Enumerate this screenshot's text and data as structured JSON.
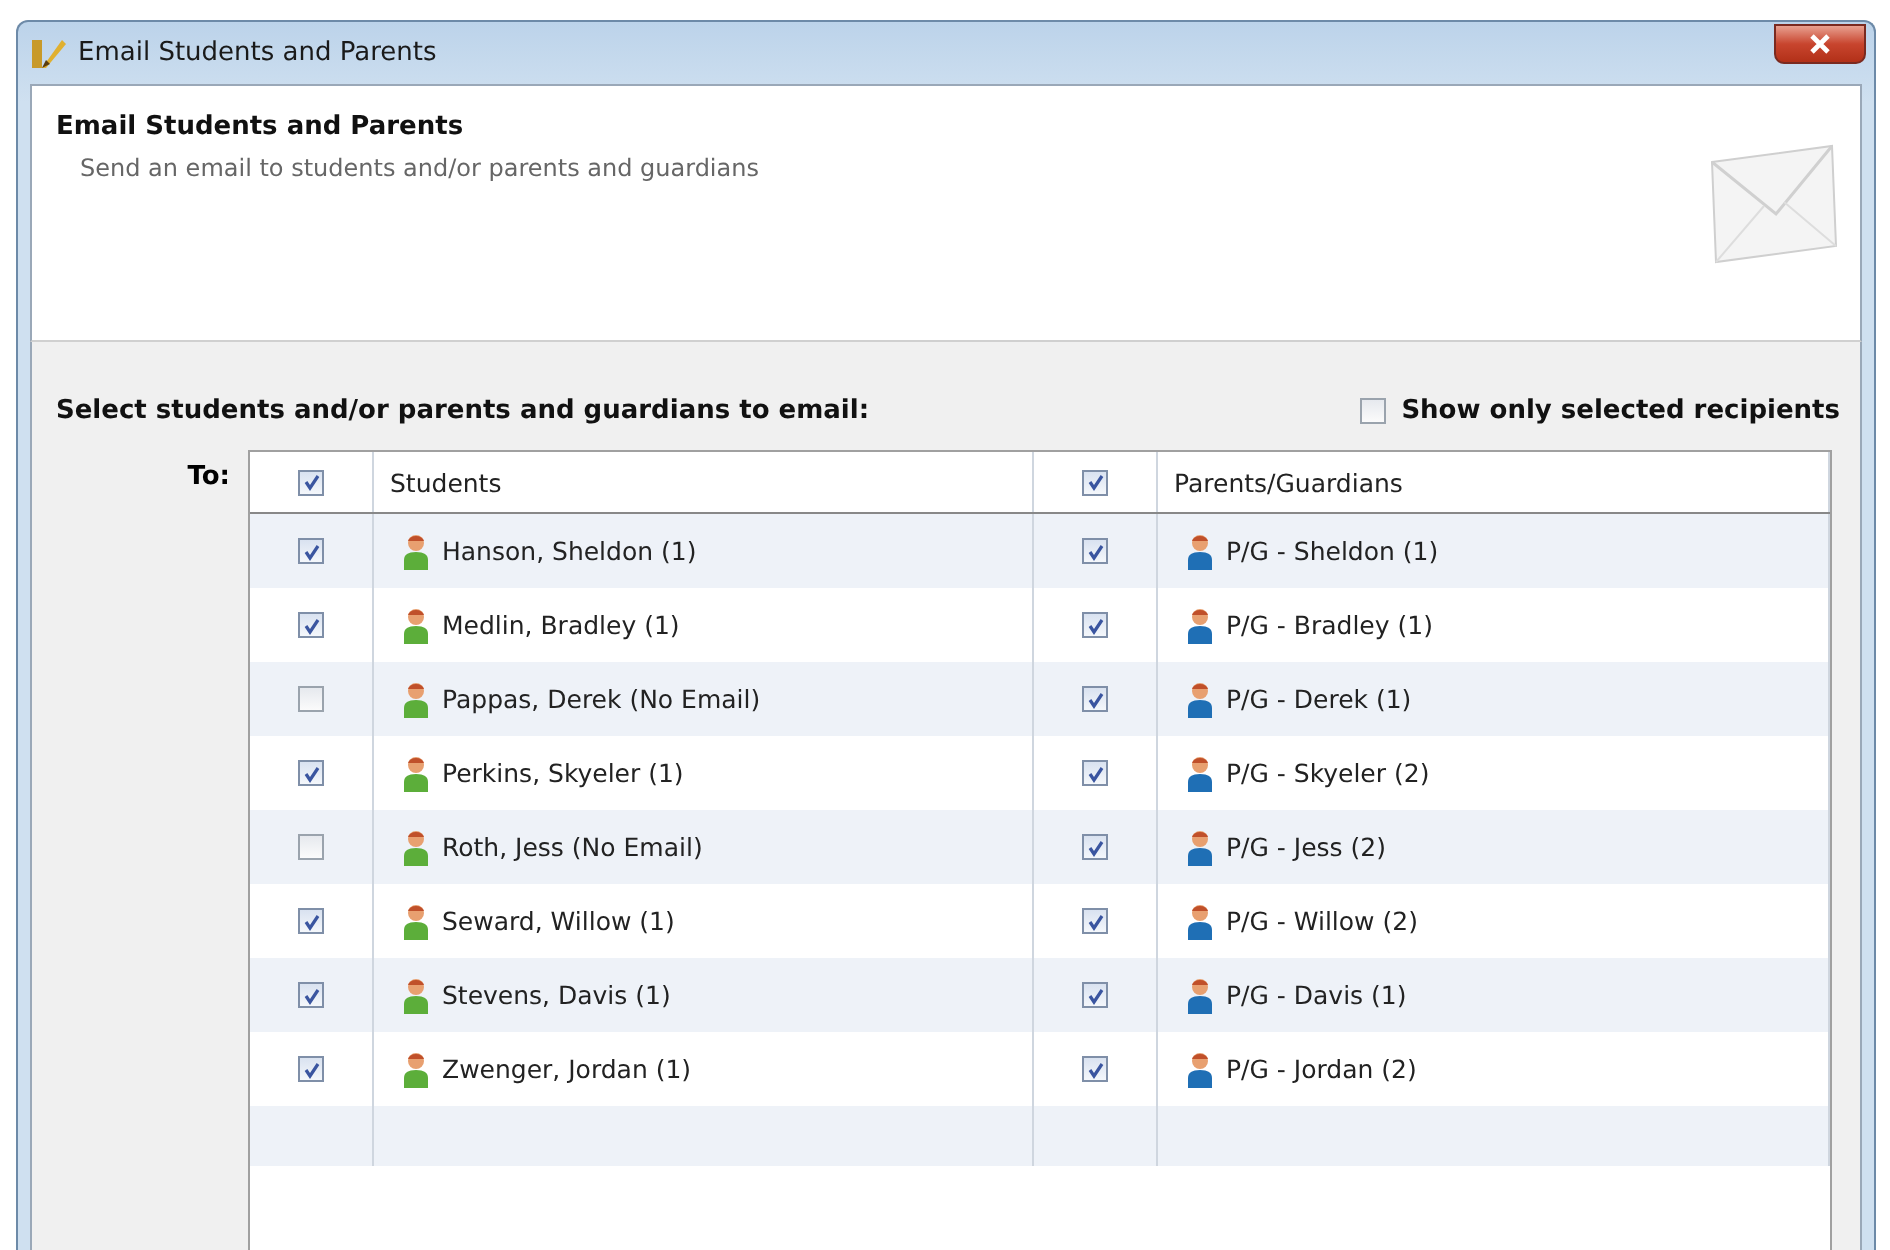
{
  "window": {
    "title": "Email Students and Parents"
  },
  "header": {
    "title": "Email Students and Parents",
    "subtitle": "Send an email to students and/or parents and guardians"
  },
  "prompt": "Select students and/or parents and guardians to email:",
  "show_only_selected": {
    "label": "Show only selected recipients",
    "checked": false
  },
  "to_label": "To:",
  "table": {
    "columns": [
      {
        "label": "Students",
        "checked": true
      },
      {
        "label": "Parents/Guardians",
        "checked": true
      }
    ],
    "rows": [
      {
        "student": {
          "name": "Hanson, Sheldon (1)",
          "checked": true
        },
        "parent": {
          "name": "P/G - Sheldon (1)",
          "checked": true
        }
      },
      {
        "student": {
          "name": "Medlin, Bradley (1)",
          "checked": true
        },
        "parent": {
          "name": "P/G - Bradley (1)",
          "checked": true
        }
      },
      {
        "student": {
          "name": "Pappas, Derek (No Email)",
          "checked": false
        },
        "parent": {
          "name": "P/G - Derek (1)",
          "checked": true
        }
      },
      {
        "student": {
          "name": "Perkins, Skyeler (1)",
          "checked": true
        },
        "parent": {
          "name": "P/G - Skyeler (2)",
          "checked": true
        }
      },
      {
        "student": {
          "name": "Roth, Jess (No Email)",
          "checked": false
        },
        "parent": {
          "name": "P/G - Jess (2)",
          "checked": true
        }
      },
      {
        "student": {
          "name": "Seward, Willow (1)",
          "checked": true
        },
        "parent": {
          "name": "P/G - Willow (2)",
          "checked": true
        }
      },
      {
        "student": {
          "name": "Stevens, Davis (1)",
          "checked": true
        },
        "parent": {
          "name": "P/G - Davis (1)",
          "checked": true
        }
      },
      {
        "student": {
          "name": "Zwenger, Jordan (1)",
          "checked": true
        },
        "parent": {
          "name": "P/G - Jordan (2)",
          "checked": true
        }
      }
    ]
  }
}
